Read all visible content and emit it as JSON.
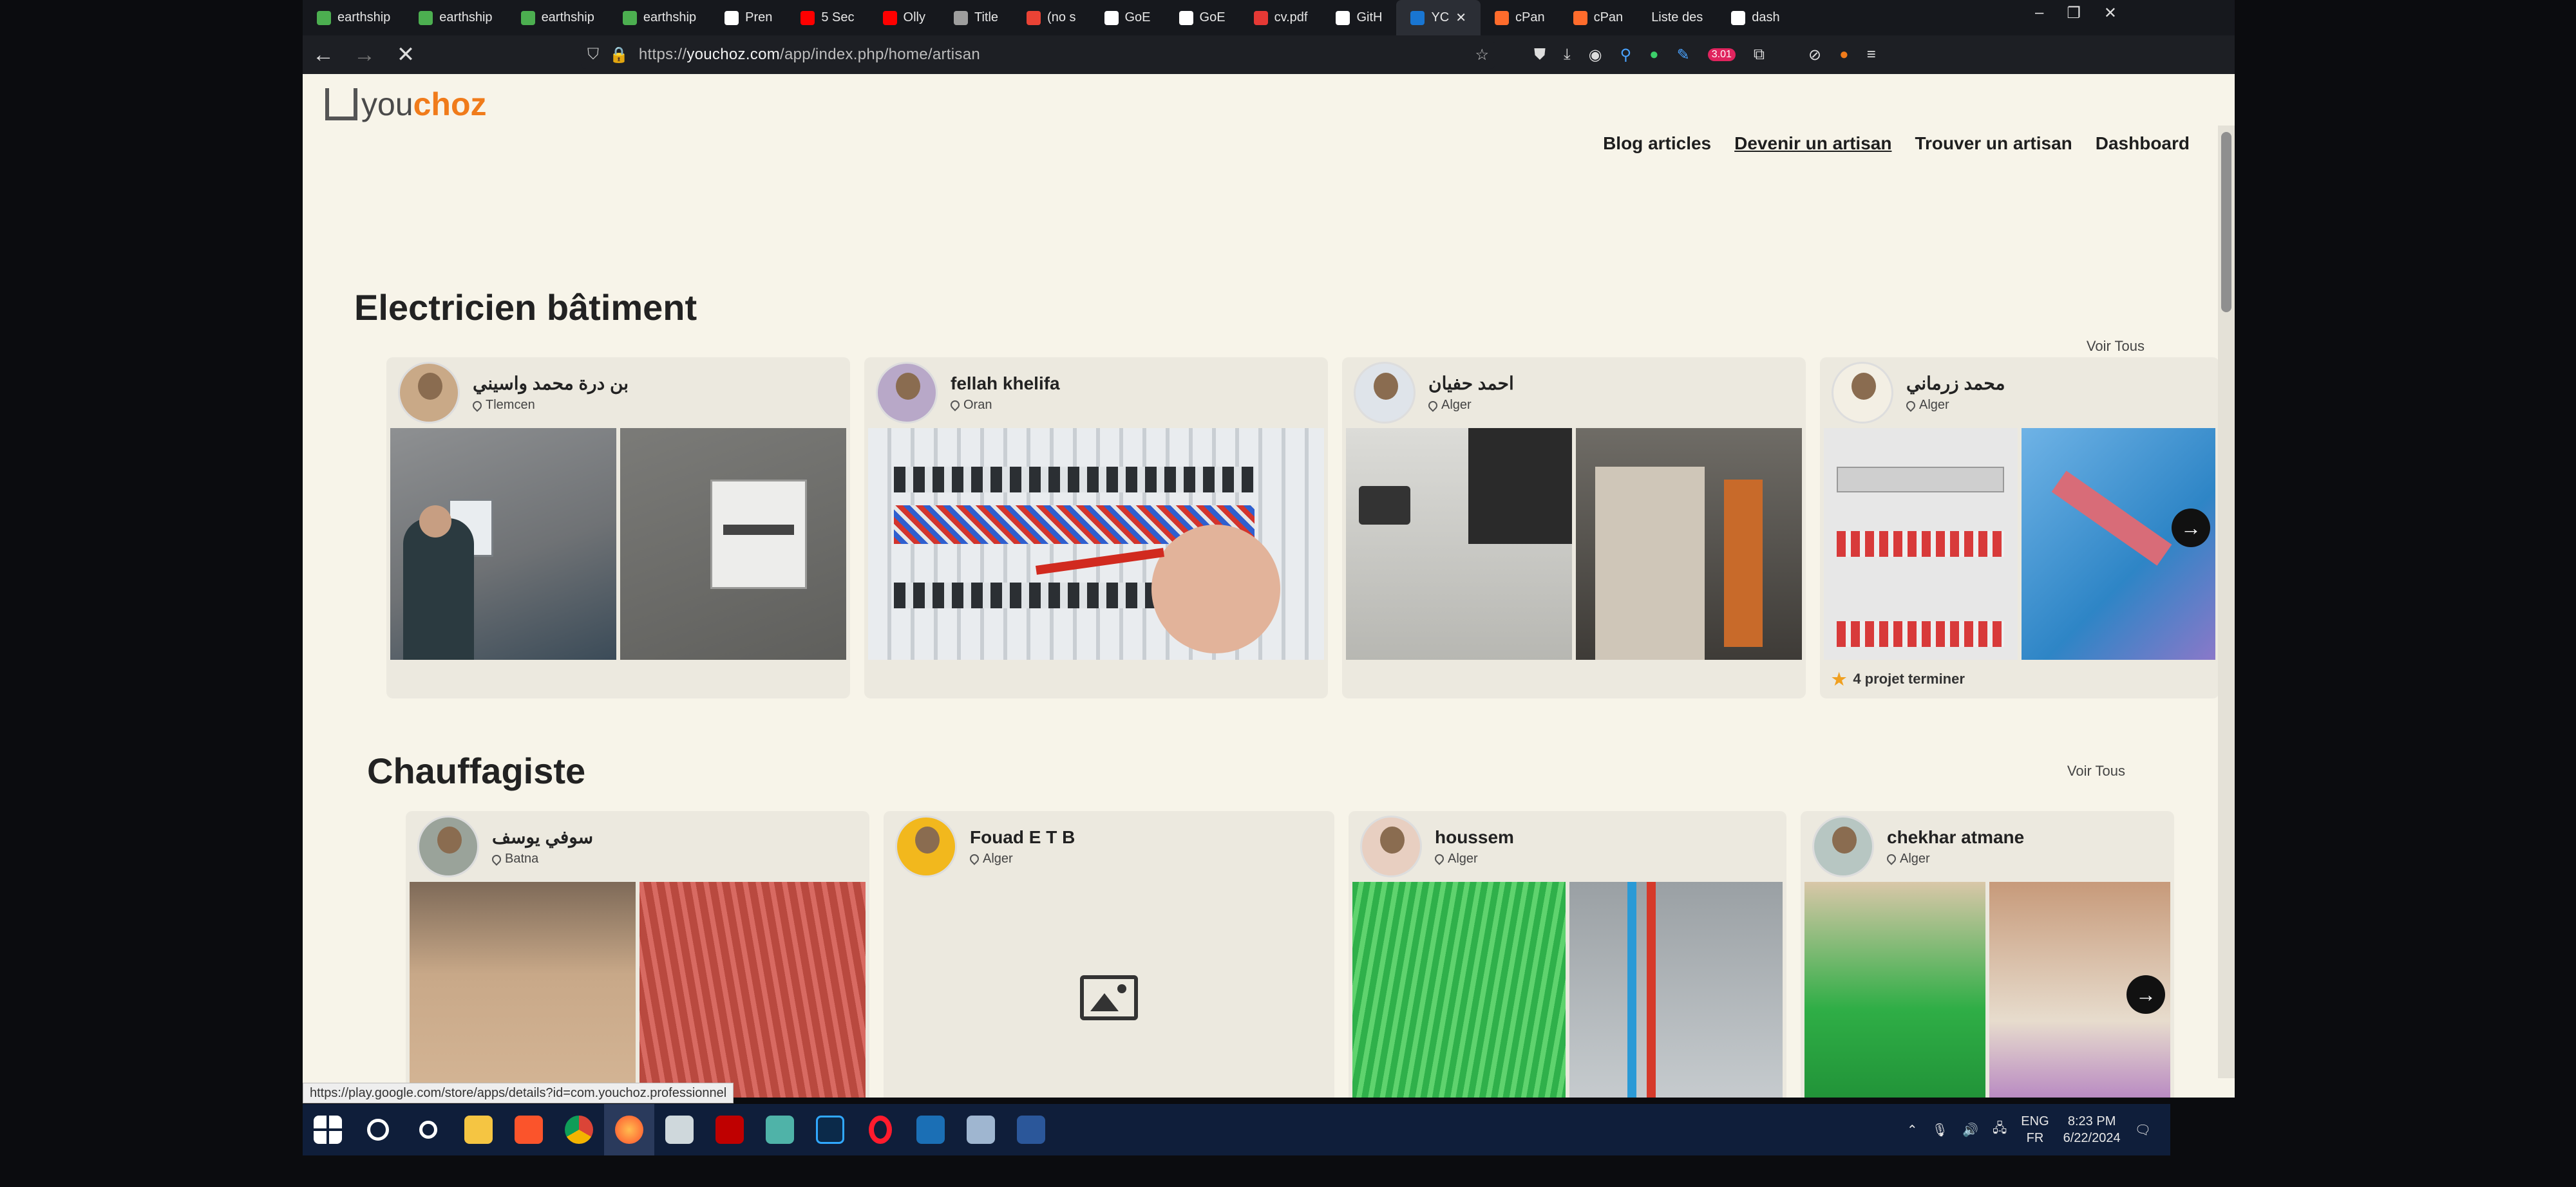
{
  "browser": {
    "tabs": [
      {
        "label": "earthship",
        "color": "#4caf50"
      },
      {
        "label": "earthship",
        "color": "#4caf50"
      },
      {
        "label": "earthship",
        "color": "#4caf50"
      },
      {
        "label": "earthship",
        "color": "#4caf50"
      },
      {
        "label": "Pren",
        "color": "#ffffff"
      },
      {
        "label": "5 Sec",
        "color": "#ff0000"
      },
      {
        "label": "Olly",
        "color": "#ff0000"
      },
      {
        "label": "Title",
        "color": "#9e9e9e"
      },
      {
        "label": "(no s",
        "color": "#ea4335"
      },
      {
        "label": "GoE",
        "color": "#ffffff"
      },
      {
        "label": "GoE",
        "color": "#ffffff"
      },
      {
        "label": "cv.pdf",
        "color": "#e53935"
      },
      {
        "label": "GitH",
        "color": "#ffffff"
      },
      {
        "label": "YC",
        "color": "#1976d2",
        "active": true
      },
      {
        "label": "cPan",
        "color": "#ff6c2c"
      },
      {
        "label": "cPan",
        "color": "#ff6c2c"
      },
      {
        "label": "Liste des",
        "color": "#ffffff"
      },
      {
        "label": "dash",
        "color": "#ffffff"
      }
    ],
    "url_prefix": "https://",
    "url_domain": "youchoz.com",
    "url_path": "/app/index.php/home/artisan",
    "notification_badge": "3.01",
    "status_link": "https://play.google.com/store/apps/details?id=com.youchoz.professionnel"
  },
  "site": {
    "logo_prefix": "you",
    "logo_accent": "choz",
    "accent_color": "#f07b1a",
    "menu": [
      "Blog articles",
      "Devenir un artisan",
      "Trouver un artisan",
      "Dashboard"
    ]
  },
  "sections": [
    {
      "title": "Electricien bâtiment",
      "see_all": "Voir Tous",
      "cards": [
        {
          "name": "بن درة محمد واسيني",
          "location": "Tlemcen"
        },
        {
          "name": "fellah khelifa",
          "location": "Oran"
        },
        {
          "name": "احمد حفيان",
          "location": "Alger"
        },
        {
          "name": "محمد زرماني",
          "location": "Alger",
          "footer": "4 projet terminer"
        }
      ]
    },
    {
      "title": "Chauffagiste",
      "see_all": "Voir Tous",
      "cards": [
        {
          "name": "سوفي يوسف",
          "location": "Batna"
        },
        {
          "name": "Fouad E T B",
          "location": "Alger"
        },
        {
          "name": "houssem",
          "location": "Alger"
        },
        {
          "name": "chekhar atmane",
          "location": "Alger"
        }
      ]
    }
  ],
  "taskbar": {
    "language": "ENG",
    "layout": "FR",
    "time": "8:23 PM",
    "date": "6/22/2024"
  }
}
